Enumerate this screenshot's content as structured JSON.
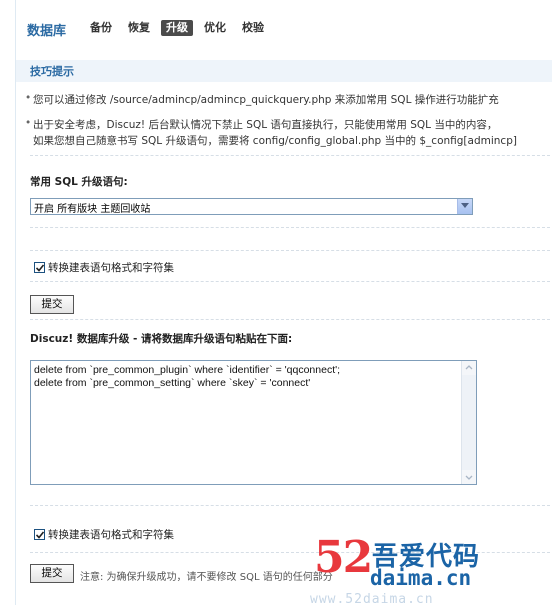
{
  "header": {
    "title": "数据库",
    "tabs": [
      {
        "label": "备份",
        "active": false
      },
      {
        "label": "恢复",
        "active": false
      },
      {
        "label": "升级",
        "active": true
      },
      {
        "label": "优化",
        "active": false
      },
      {
        "label": "校验",
        "active": false
      }
    ]
  },
  "tips": {
    "title": "技巧提示",
    "items": [
      "您可以通过修改 /source/admincp/admincp_quickquery.php 来添加常用 SQL 操作进行功能扩充",
      "出于安全考虑，Discuz! 后台默认情况下禁止 SQL 语句直接执行，只能使用常用 SQL 当中的内容，",
      "如果您想自己随意书写 SQL 升级语句，需要将 config/config_global.php 当中的 $_config[admincp]"
    ]
  },
  "common_sql": {
    "label": "常用 SQL 升级语句:",
    "selected": "开启 所有版块 主题回收站",
    "checkbox_label": "转换建表语句格式和字符集",
    "checkbox_checked": true,
    "submit_label": "提交"
  },
  "upgrade": {
    "label": "Discuz! 数据库升级 - 请将数据库升级语句粘贴在下面:",
    "sql_lines": [
      "delete from `pre_common_plugin` where `identifier` = 'qqconnect';",
      "delete from `pre_common_setting` where `skey` = 'connect'"
    ],
    "checkbox_label": "转换建表语句格式和字符集",
    "checkbox_checked": true,
    "submit_label": "提交",
    "note": "注意: 为确保升级成功，请不要修改 SQL 语句的任何部分"
  },
  "watermark": {
    "number": "52",
    "cn": "吾爱代码",
    "domain": "daima.cn",
    "faint": "www.52daima.cn"
  }
}
